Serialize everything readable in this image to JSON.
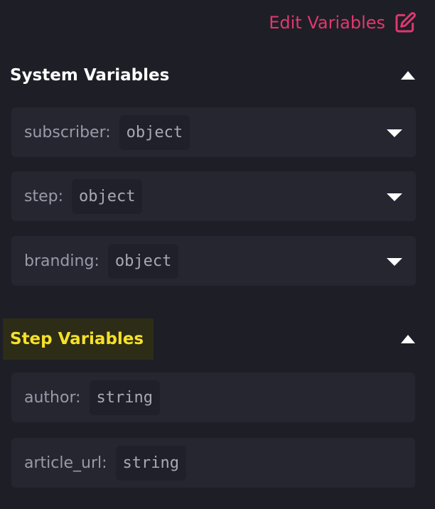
{
  "header": {
    "edit_label": "Edit Variables"
  },
  "system_section": {
    "title": "System Variables",
    "variables": [
      {
        "name": "subscriber:",
        "type": "object"
      },
      {
        "name": "step:",
        "type": "object"
      },
      {
        "name": "branding:",
        "type": "object"
      }
    ]
  },
  "step_section": {
    "title": "Step Variables",
    "variables": [
      {
        "name": "author:",
        "type": "string"
      },
      {
        "name": "article_url:",
        "type": "string"
      }
    ]
  },
  "colors": {
    "background": "#1e1e26",
    "row_background": "#262631",
    "accent_pink": "#e0386e",
    "highlight_yellow": "#f5e12a"
  },
  "icons": {
    "edit": "edit-square-icon",
    "collapse": "caret-up-icon",
    "expand": "caret-down-icon"
  }
}
